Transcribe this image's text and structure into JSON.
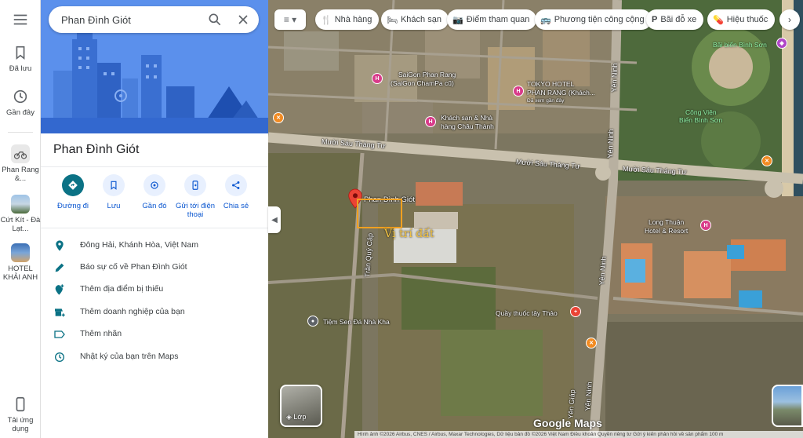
{
  "search": {
    "value": "Phan Đình Giót"
  },
  "rail": {
    "menu_icon": "menu-icon",
    "saved_label": "Đã lưu",
    "recent_label": "Gần đây",
    "history": [
      {
        "label": "Phan Rang &...",
        "icon": "place-thumbnail"
      },
      {
        "label": "Cứt Kít - Đà Lạt...",
        "icon": "place-thumbnail"
      },
      {
        "label": "HOTEL KHẢI ANH",
        "icon": "place-thumbnail"
      }
    ],
    "app_label": "Tải ứng dụng"
  },
  "place": {
    "title": "Phan Đình Giót",
    "actions": [
      {
        "label": "Đường đi",
        "icon": "directions-icon"
      },
      {
        "label": "Lưu",
        "icon": "bookmark-icon"
      },
      {
        "label": "Gần đó",
        "icon": "nearby-icon"
      },
      {
        "label": "Gửi tới điện thoại",
        "icon": "send-to-phone-icon"
      },
      {
        "label": "Chia sẻ",
        "icon": "share-icon"
      }
    ],
    "info": [
      {
        "text": "Đông Hải, Khánh Hòa, Việt Nam",
        "icon": "location-pin-icon"
      },
      {
        "text": "Báo sự cố về Phan Đình Giót",
        "icon": "pencil-icon"
      },
      {
        "text": "Thêm địa điểm bị thiếu",
        "icon": "add-location-icon"
      },
      {
        "text": "Thêm doanh nghiệp của bạn",
        "icon": "add-business-icon"
      },
      {
        "text": "Thêm nhãn",
        "icon": "label-icon"
      },
      {
        "text": "Nhật ký của bạn trên Maps",
        "icon": "history-icon"
      }
    ]
  },
  "chips": [
    {
      "label": "Nhà hàng",
      "icon": "restaurant-icon"
    },
    {
      "label": "Khách sạn",
      "icon": "hotel-icon"
    },
    {
      "label": "Điểm tham quan",
      "icon": "camera-icon"
    },
    {
      "label": "Phương tiện công cộng",
      "icon": "transit-icon"
    },
    {
      "label": "Bãi đỗ xe",
      "icon": "parking-icon"
    },
    {
      "label": "Hiệu thuốc",
      "icon": "pharmacy-icon"
    }
  ],
  "map": {
    "labels": {
      "saigon_phan_rang": "SaiGon Phan Rang",
      "saigon_champa": "(SaiGon ChamPa cũ)",
      "tokyo_hotel": "TOKYO HOTEL",
      "tokyo_hotel_2": "PHAN RANG (Khách...",
      "tokyo_recent": "Đã xem gần đây",
      "chau_thanh": "Khách sạn & Nhà",
      "chau_thanh_2": "hàng Châu Thành",
      "bai_bien": "Bãi biển Bình Sơn",
      "cong_vien": "Công Viên",
      "cong_vien_2": "Biển Bình Sơn",
      "muoi_sau_1": "Mười Sáu Tháng Tư",
      "muoi_sau_2": "Mười Sáu Tháng Tư",
      "muoi_sau_3": "Mười Sáu Tháng Tư",
      "yen_ninh_1": "Yên Ninh",
      "yen_ninh_2": "Yên Ninh",
      "yen_ninh_3": "Yên Ninh",
      "yen_ninh_4": "Yên Ninh",
      "phan_dinh_giot": "Phan Đình Giót",
      "long_thuan": "Long Thuận",
      "long_thuan_2": "Hotel & Resort",
      "tran_quy_cap": "Trần Quý Cáp",
      "quay_thuoc": "Quầy thuốc tây Thảo",
      "tiem_sen": "Tiệm Sen Đá Nhà Kha",
      "nguyen_giap": "Yên Giáp",
      "vi_tri_dat": "Vị trí đất"
    },
    "layer_label": "Lớp",
    "google": "Google Maps",
    "attribution": "Hình ảnh ©2026 Airbus, CNES / Airbus, Maxar Technologies, Dữ liệu bản đồ ©2026   Việt Nam   Điều khoản   Quyền riêng tư   Gửi ý kiến phản hồi về sản phẩm   100 m"
  },
  "colors": {
    "accent": "#0b7285",
    "link": "#0b57d0",
    "pin_red": "#ea4335",
    "hotel_pink": "#d93b8a",
    "food_orange": "#f28b22"
  }
}
